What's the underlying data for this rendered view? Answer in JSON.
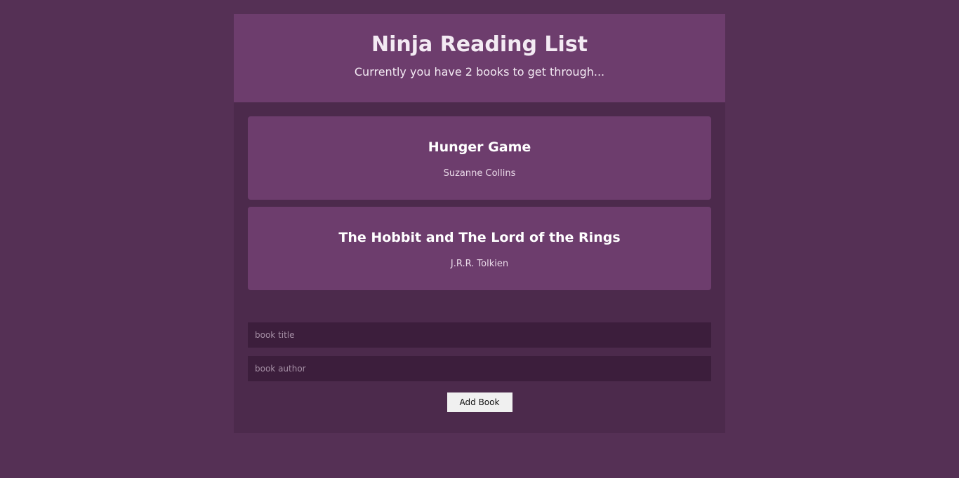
{
  "navbar": {
    "title": "Ninja Reading List",
    "subtitle": "Currently you have 2 books to get through..."
  },
  "books": [
    {
      "title": "Hunger Game",
      "author": "Suzanne Collins"
    },
    {
      "title": "The Hobbit and The Lord of the Rings",
      "author": "J.R.R. Tolkien"
    }
  ],
  "form": {
    "title_placeholder": "book title",
    "author_placeholder": "book author",
    "submit_label": "Add Book"
  },
  "colors": {
    "background": "#553055",
    "panel": "#4c2a4c",
    "card": "#6d3d6d",
    "input": "#3c1e3c"
  }
}
